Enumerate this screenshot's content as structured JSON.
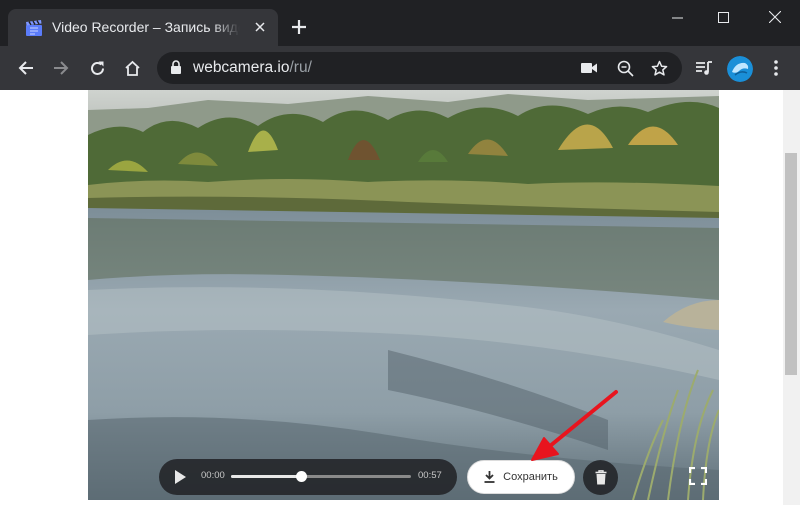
{
  "tab": {
    "title": "Video Recorder – Запись видео с"
  },
  "address_bar": {
    "host": "webcamera.io",
    "path": "/ru/"
  },
  "player": {
    "current_time": "00:00",
    "duration": "00:57",
    "progress": 0.39
  },
  "buttons": {
    "save_label": "Сохранить"
  },
  "colors": {
    "chrome_dark": "#202124",
    "chrome_toolbar": "#35363a",
    "annotation_arrow": "#e8141e"
  }
}
